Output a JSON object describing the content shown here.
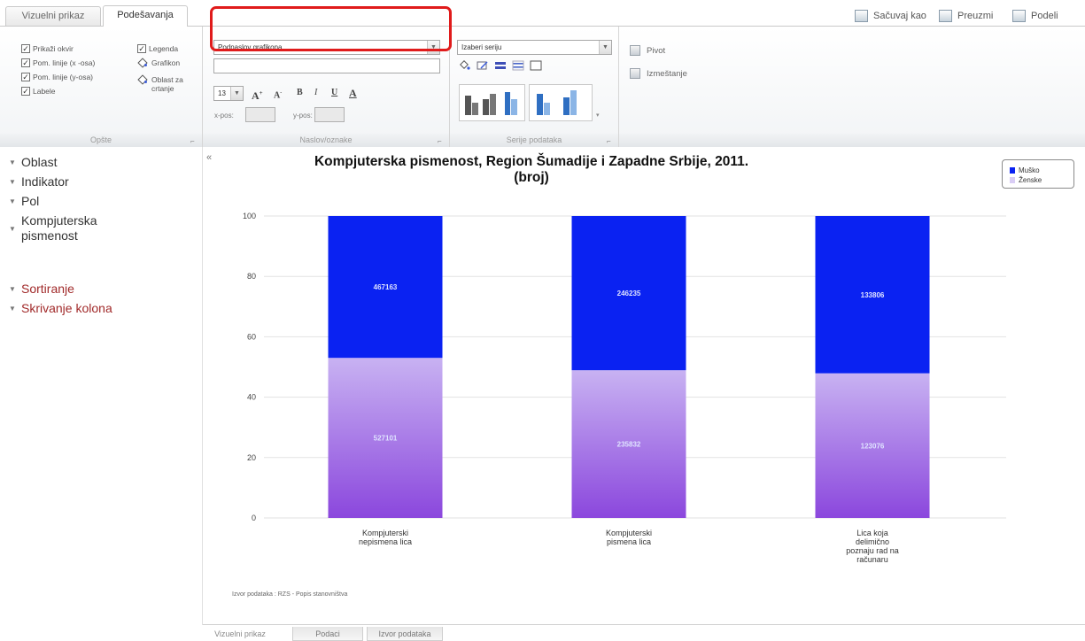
{
  "tabs": {
    "visual": "Vizuelni prikaz",
    "settings": "Podešavanja"
  },
  "actions": {
    "save_as": "Sačuvaj kao",
    "download": "Preuzmi",
    "share": "Podeli"
  },
  "ribbon": {
    "options": {
      "show_frame": "Prikaži okvir",
      "grid_x": "Pom. linije (x -osa)",
      "grid_y": "Pom. linije (y-osa)",
      "labels": "Labele",
      "legend": "Legenda",
      "chart": "Grafikon",
      "area_line1": "Oblast za",
      "area_line2": "crtanje",
      "group_label": "Opšte"
    },
    "titles": {
      "title_select": "Podnaslov grafikona",
      "title_text": "",
      "font_size": "13",
      "x_pos_label": "x-pos:",
      "y_pos_label": "y-pos:",
      "group_label": "Naslov/oznake"
    },
    "series": {
      "series_select": "Izaberi seriju",
      "group_label": "Serije podataka"
    },
    "pivot": {
      "pivot": "Pivot",
      "transpose": "Izmeštanje"
    }
  },
  "left_panel": {
    "items": [
      "Oblast",
      "Indikator",
      "Pol",
      "Kompjuterska",
      "pismenost"
    ],
    "red_items": [
      "Sortiranje",
      "Skrivanje kolona"
    ]
  },
  "chart_title_line1": "Kompjuterska pismenost, Region Šumadije i Zapadne Srbije, 2011.",
  "chart_title_line2": "(broj)",
  "source": "Izvor podataka : RZS - Popis stanovništva",
  "bottom_tabs": {
    "visual": "Vizuelni prikaz",
    "data": "Podaci",
    "source": "Izvor podataka"
  },
  "colors": {
    "male": "#0a22f2",
    "female_top": "#c8b2f2",
    "female_bottom": "#8b47dd",
    "highlight": "#e01b1b"
  },
  "chart_data": {
    "type": "bar",
    "stacked": "percent",
    "categories": [
      [
        "Kompjuterski",
        "nepismena lica"
      ],
      [
        "Kompjuterski",
        "pismena lica"
      ],
      [
        "Lica koja",
        "delimično",
        "poznaju rad na",
        "računaru"
      ]
    ],
    "series": [
      {
        "name": "Ženske",
        "values": [
          527101,
          235832,
          123076
        ]
      },
      {
        "name": "Muško",
        "values": [
          467163,
          246235,
          133806
        ]
      }
    ],
    "yticks": [
      "100",
      "80",
      "60",
      "40",
      "20",
      "0"
    ],
    "ylim": [
      0,
      100
    ],
    "legend": "top-right"
  }
}
